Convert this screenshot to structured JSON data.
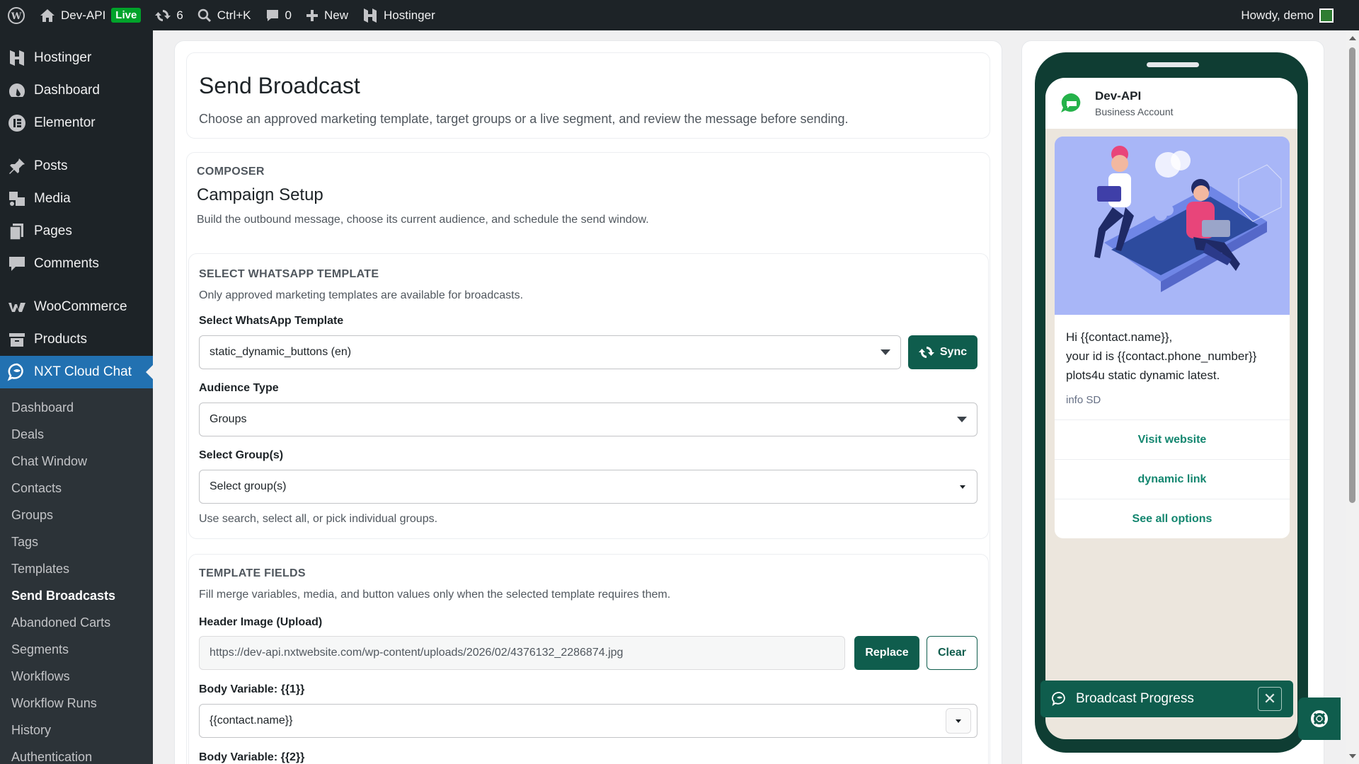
{
  "admin_bar": {
    "site_name": "Dev-API",
    "live_badge": "Live",
    "updates_count": "6",
    "search_shortcut": "Ctrl+K",
    "comments_count": "0",
    "new_label": "New",
    "hosting_label": "Hostinger",
    "greeting": "Howdy, demo"
  },
  "sidebar": {
    "items": [
      {
        "label": "Hostinger",
        "icon": "hostinger-icon"
      },
      {
        "label": "Dashboard",
        "icon": "dashboard-icon"
      },
      {
        "label": "Elementor",
        "icon": "elementor-icon"
      },
      {
        "label": "Posts",
        "icon": "pin-icon"
      },
      {
        "label": "Media",
        "icon": "media-icon"
      },
      {
        "label": "Pages",
        "icon": "pages-icon"
      },
      {
        "label": "Comments",
        "icon": "comment-icon"
      },
      {
        "label": "WooCommerce",
        "icon": "woo-icon"
      },
      {
        "label": "Products",
        "icon": "archive-icon"
      },
      {
        "label": "NXT Cloud Chat",
        "icon": "chat-icon"
      }
    ],
    "submenu": [
      "Dashboard",
      "Deals",
      "Chat Window",
      "Contacts",
      "Groups",
      "Tags",
      "Templates",
      "Send Broadcasts",
      "Abandoned Carts",
      "Segments",
      "Workflows",
      "Workflow Runs",
      "History",
      "Authentication"
    ],
    "current_submenu": "Send Broadcasts"
  },
  "page": {
    "title": "Send Broadcast",
    "description": "Choose an approved marketing template, target groups or a live segment, and review the message before sending."
  },
  "composer": {
    "eyebrow": "COMPOSER",
    "title": "Campaign Setup",
    "description": "Build the outbound message, choose its current audience, and schedule the send window."
  },
  "template_section": {
    "eyebrow": "SELECT WHATSAPP TEMPLATE",
    "help": "Only approved marketing templates are available for broadcasts.",
    "template_label": "Select WhatsApp Template",
    "template_value": "static_dynamic_buttons (en)",
    "sync_label": "Sync",
    "audience_label": "Audience Type",
    "audience_value": "Groups",
    "groups_label": "Select Group(s)",
    "groups_placeholder": "Select group(s)",
    "groups_help": "Use search, select all, or pick individual groups."
  },
  "fields_section": {
    "eyebrow": "TEMPLATE FIELDS",
    "help": "Fill merge variables, media, and button values only when the selected template requires them.",
    "header_image_label": "Header Image (Upload)",
    "header_image_value": "https://dev-api.nxtwebsite.com/wp-content/uploads/2026/02/4376132_2286874.jpg",
    "replace_label": "Replace",
    "clear_label": "Clear",
    "body_var1_label": "Body Variable: {{1}}",
    "body_var1_value": "{{contact.name}}",
    "body_var2_label": "Body Variable: {{2}}"
  },
  "preview": {
    "business_name": "Dev-API",
    "business_sub": "Business Account",
    "message_line1": "Hi {{contact.name}},",
    "message_line2": "your id is {{contact.phone_number}}",
    "message_line3": "plots4u static dynamic latest.",
    "footer": "info SD",
    "buttons": [
      "Visit website",
      "dynamic link",
      "See all options"
    ]
  },
  "toast": {
    "label": "Broadcast Progress",
    "close_symbol": "✕"
  },
  "colors": {
    "brand": "#0f5d4d",
    "admin_bg": "#1d2327",
    "active_menu": "#2271b1",
    "link_green": "#13866f"
  }
}
